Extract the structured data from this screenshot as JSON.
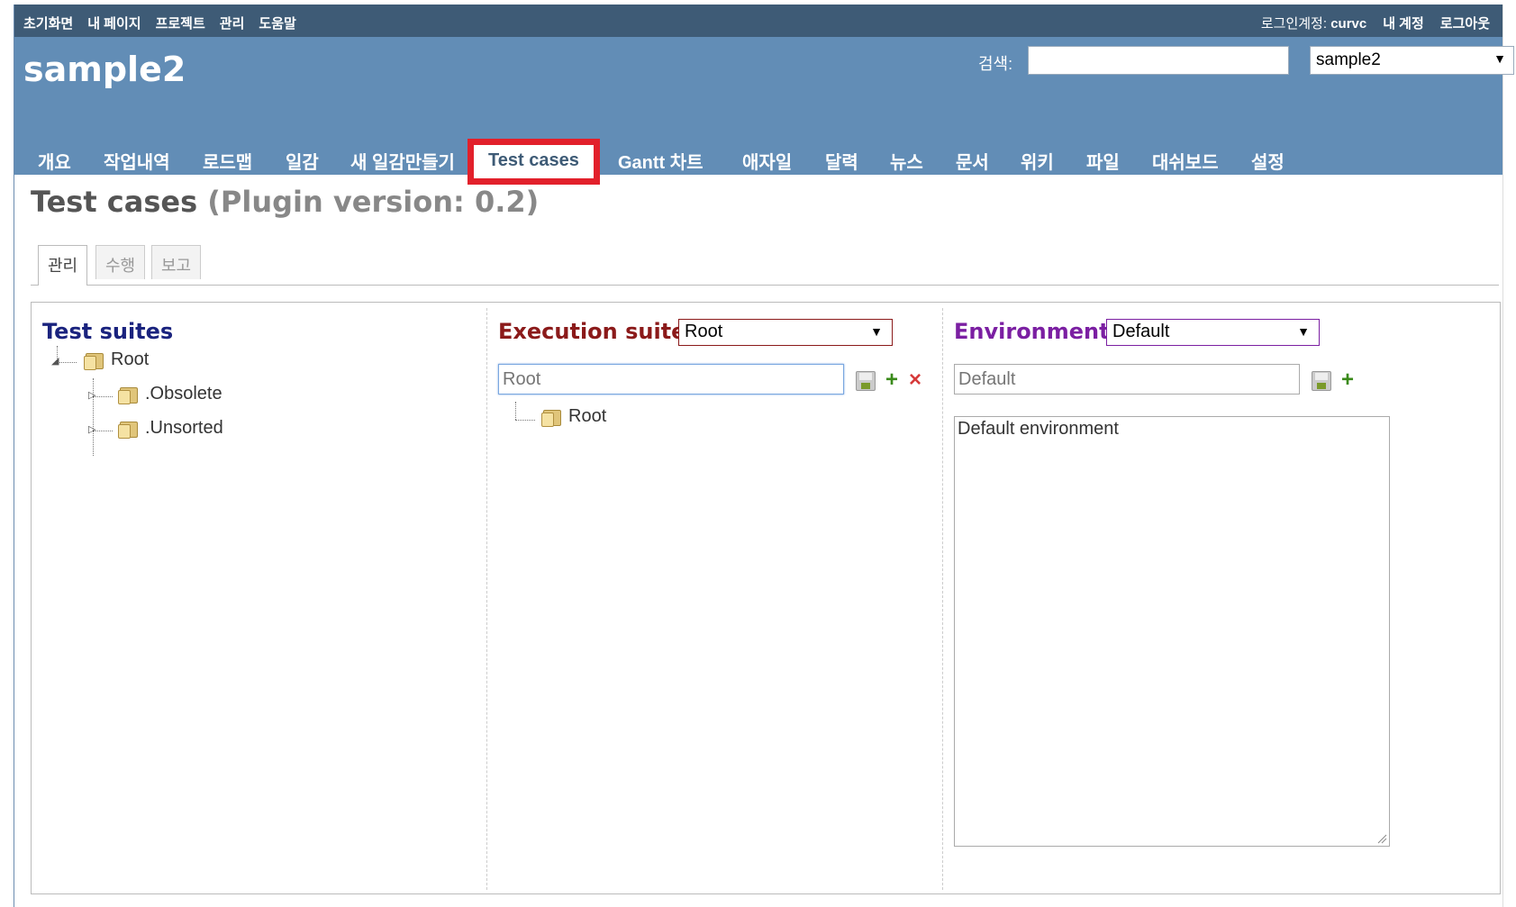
{
  "topbar": {
    "left_links": [
      "초기화면",
      "내 페이지",
      "프로젝트",
      "관리",
      "도움말"
    ],
    "login_label": "로그인계정:",
    "login_user": "curvc",
    "my_account": "내 계정",
    "logout": "로그아웃"
  },
  "header": {
    "project_title": "sample2",
    "search_label": "검색:",
    "search_value": "",
    "project_select_value": "sample2",
    "select_arrow": "▼"
  },
  "mainnav": {
    "tabs": [
      "개요",
      "작업내역",
      "로드맵",
      "일감",
      "새 일감만들기",
      "Test cases",
      "Gantt 차트",
      "애자일",
      "달력",
      "뉴스",
      "문서",
      "위키",
      "파일",
      "대쉬보드",
      "설정"
    ],
    "selected": "Test cases"
  },
  "page": {
    "heading": "Test cases",
    "version": "(Plugin version: 0.2)"
  },
  "subtabs": [
    "관리",
    "수행",
    "보고"
  ],
  "test_suites": {
    "title": "Test suites",
    "root": "Root",
    "children": [
      ".Obsolete",
      ".Unsorted"
    ]
  },
  "execution_suite": {
    "label": "Execution suite:",
    "selected": "Root",
    "input_placeholder": "Root",
    "tree_root": "Root",
    "add_icon": "+",
    "delete_icon": "×"
  },
  "environment": {
    "label": "Environment:",
    "selected": "Default",
    "input_placeholder": "Default",
    "add_icon": "+",
    "description": "Default environment"
  },
  "colors": {
    "topbar": "#3e5b76",
    "header": "#628db6",
    "suite_title": "#1a237e",
    "execution_title": "#8b1a1a",
    "environment_title": "#7b1fa2",
    "highlight": "#e2202b"
  }
}
